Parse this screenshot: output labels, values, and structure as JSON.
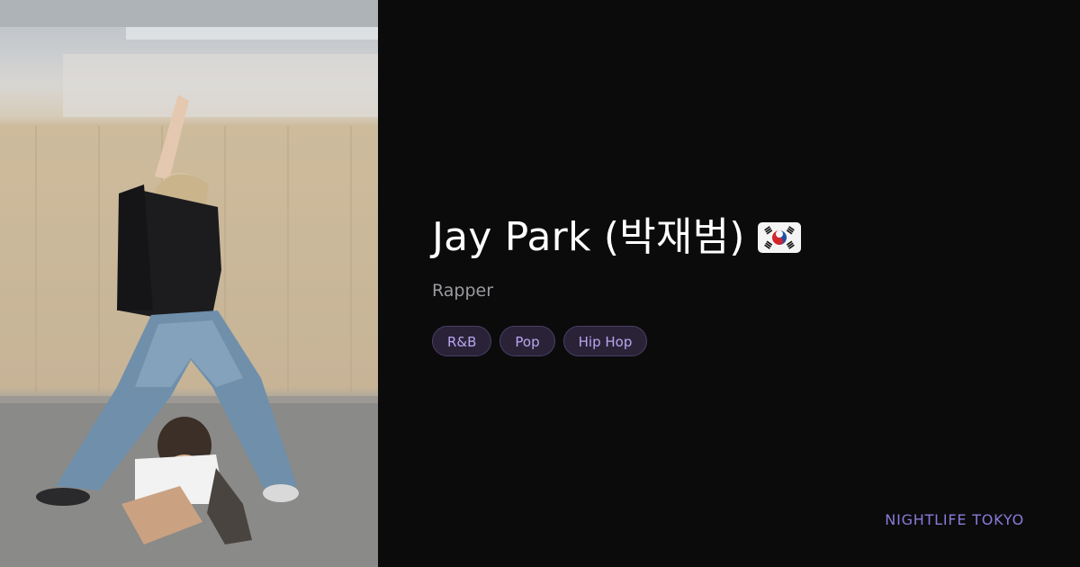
{
  "artist": {
    "name": "Jay Park (박재범)",
    "country_flag": "south-korea-flag-icon",
    "role": "Rapper"
  },
  "tags": [
    {
      "label": "R&B"
    },
    {
      "label": "Pop"
    },
    {
      "label": "Hip Hop"
    }
  ],
  "brand": {
    "name": "NIGHTLIFE TOKYO"
  },
  "colors": {
    "background": "#0b0b0c",
    "title": "#ffffff",
    "role": "#9a9a9f",
    "tag_bg": "#2a2338",
    "tag_border": "#4a3f63",
    "tag_text": "#b9a6f0",
    "brand": "#8c7ad8"
  }
}
